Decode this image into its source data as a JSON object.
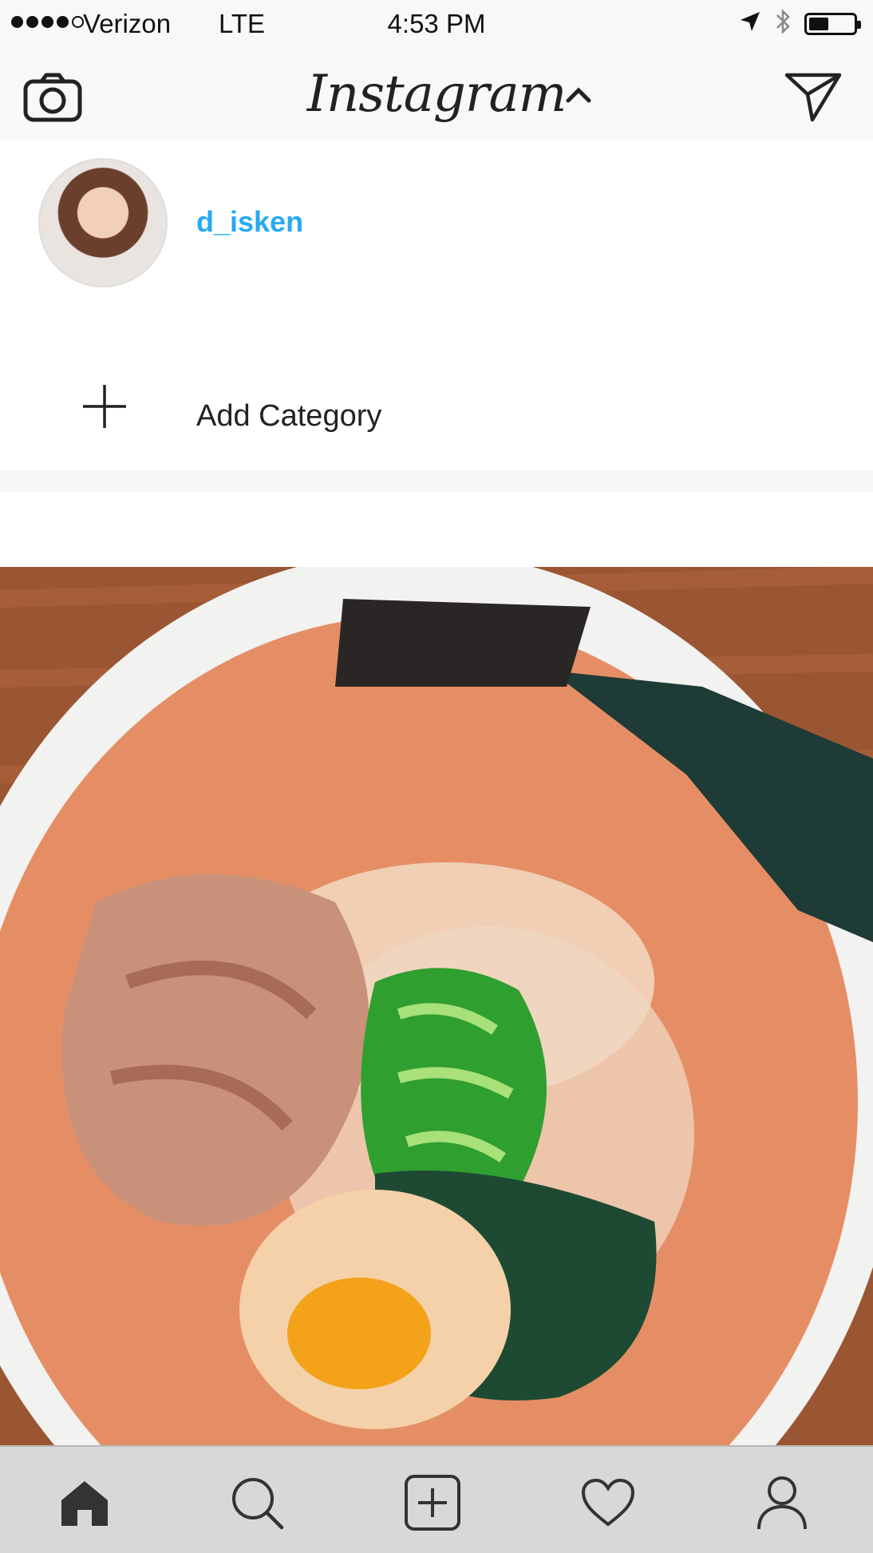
{
  "status_bar": {
    "carrier": "Verizon",
    "network": "LTE",
    "time": "4:53 PM",
    "signal_bars": 4,
    "battery_level": 0.45
  },
  "header": {
    "title": "Instagram",
    "camera_icon": "camera-icon",
    "chevron_icon": "chevron-up-icon",
    "send_icon": "paper-plane-icon"
  },
  "account_switcher": {
    "username": "d_isken",
    "add_label": "Add Category"
  },
  "tab_bar": {
    "items": [
      "home-icon",
      "search-icon",
      "add-post-icon",
      "heart-icon",
      "profile-icon"
    ],
    "active": "home-icon"
  },
  "colors": {
    "username": "#27a9f2",
    "bar_background": "#f8f8f8",
    "tab_background": "#d8d8d8"
  }
}
